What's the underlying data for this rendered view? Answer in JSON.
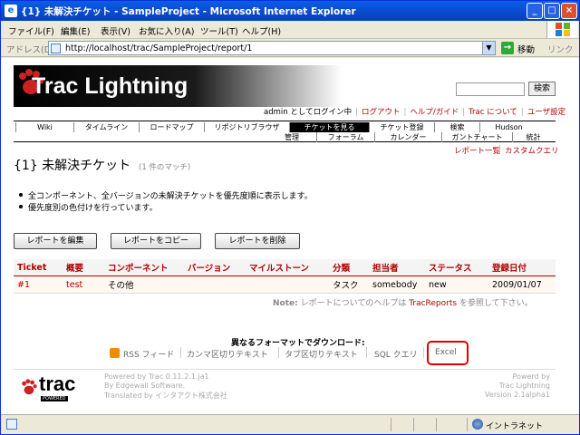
{
  "window": {
    "title": "{1} 未解決チケット - SampleProject - Microsoft Internet Explorer"
  },
  "menubar": [
    "ファイル(F)",
    "編集(E)",
    "表示(V)",
    "お気に入り(A)",
    "ツール(T)",
    "ヘルプ(H)"
  ],
  "address": {
    "label": "アドレス(D)",
    "url": "http://localhost/trac/SampleProject/report/1",
    "go": "移動",
    "links": "リンク"
  },
  "banner": {
    "title": "Trac Lightning"
  },
  "search": {
    "button": "検索"
  },
  "metanav": {
    "login": "admin としてログイン中",
    "logout": "ログアウト",
    "help": "ヘルプ/ガイド",
    "about": "Trac について",
    "prefs": "ユーザ設定"
  },
  "mainnav": [
    "Wiki",
    "タイムライン",
    "ロードマップ",
    "リポジトリブラウザ",
    "チケットを見る",
    "チケット登録",
    "検索",
    "Hudson",
    "管理",
    "フォーラム",
    "カレンダー",
    "ガントチャート",
    "統計"
  ],
  "ctxnav": {
    "report_list": "レポート一覧",
    "custom_query": "カスタムクエリ"
  },
  "page": {
    "title": "{1} 未解決チケット",
    "match": "(1 件のマッチ)"
  },
  "description": [
    "全コンポーネント、全バージョンの未解決チケットを優先度順に表示します。",
    "優先度別の色付けを行っています。"
  ],
  "buttons": {
    "edit": "レポートを編集",
    "copy": "レポートをコピー",
    "delete": "レポートを削除"
  },
  "table": {
    "headers": [
      "Ticket",
      "概要",
      "コンポーネント",
      "バージョン",
      "マイルストーン",
      "分類",
      "担当者",
      "ステータス",
      "登録日付"
    ],
    "rows": [
      [
        "#1",
        "test",
        "その他",
        "",
        "",
        "タスク",
        "somebody",
        "new",
        "2009/01/07"
      ]
    ]
  },
  "note": {
    "label": "Note:",
    "pre": "レポートについてのヘルプは ",
    "link": "TracReports",
    "post": " を参照して下さい。"
  },
  "download": {
    "title": "異なるフォーマットでダウンロード:",
    "rss": "RSS フィード",
    "csv": "カンマ区切りテキスト",
    "tsv": "タブ区切りテキスト",
    "sql": "SQL クエリ",
    "excel": "Excel"
  },
  "footer": {
    "logo": "trac",
    "logo_sub": "POWERED",
    "left": [
      "Powered by Trac 0.11.2.1.ja1",
      "By Edgewall Software.",
      "Translated by インタアクト株式会社"
    ],
    "right": [
      "Powerd by",
      "Trac Lightning",
      "Version 2.1alpha1"
    ]
  },
  "statusbar": {
    "zone": "イントラネット"
  },
  "colors": {
    "accent": "#b00000",
    "highlight": "#e00000",
    "titlebar": "#0a4fd6"
  }
}
